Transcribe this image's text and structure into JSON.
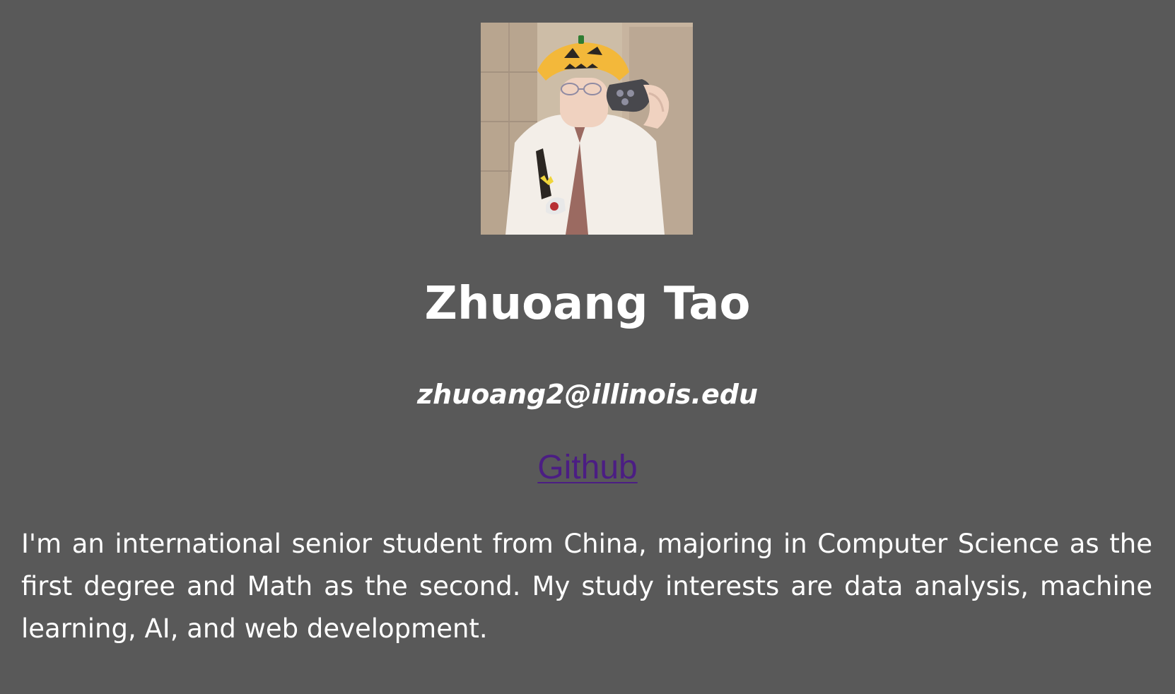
{
  "profile": {
    "photo_alt": "Zhuoang Tao profile photo",
    "name": "Zhuoang Tao",
    "email": "zhuoang2@illinois.edu",
    "github_label": "Github",
    "bio": "I'm an international senior student from China, majoring in Computer Science as the first degree and Math as the second. My study interests are data analysis, machine learning, AI, and web development."
  },
  "colors": {
    "background": "#595959",
    "text": "#ffffff",
    "link": "#4b1d83"
  }
}
